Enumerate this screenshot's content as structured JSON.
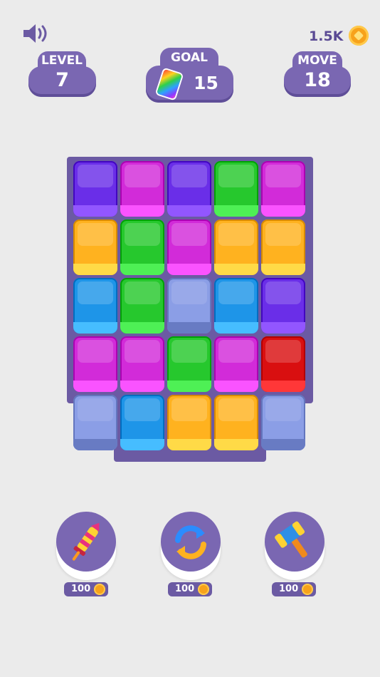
{
  "hud": {
    "coins": "1.5K",
    "level_label": "LEVEL",
    "level_value": "7",
    "goal_label": "GOAL",
    "goal_value": "15",
    "move_label": "MOVE",
    "move_value": "18"
  },
  "icons": {
    "sound": "speaker-icon",
    "coin": "coin-icon",
    "goal": "rainbow-card-icon"
  },
  "board": {
    "rows": [
      [
        "purple",
        "magenta",
        "purple",
        "green",
        "magenta"
      ],
      [
        "orange",
        "green",
        "magenta",
        "orange",
        "orange"
      ],
      [
        "blue",
        "green",
        "empty",
        "blue",
        "purple"
      ],
      [
        "magenta",
        "magenta",
        "green",
        "magenta",
        "red"
      ],
      [
        "empty",
        "blue",
        "orange",
        "orange",
        "empty"
      ]
    ]
  },
  "colors": {
    "purple": "#6a2ee8",
    "magenta": "#d22bd9",
    "green": "#26c82d",
    "orange": "#ffb21f",
    "blue": "#1e95e8",
    "red": "#d90f10",
    "empty": "#8b9ee6",
    "accent": "#7a67b2"
  },
  "tools": [
    {
      "name": "rocket",
      "price": "100"
    },
    {
      "name": "shuffle",
      "price": "100"
    },
    {
      "name": "hammer",
      "price": "100"
    }
  ]
}
